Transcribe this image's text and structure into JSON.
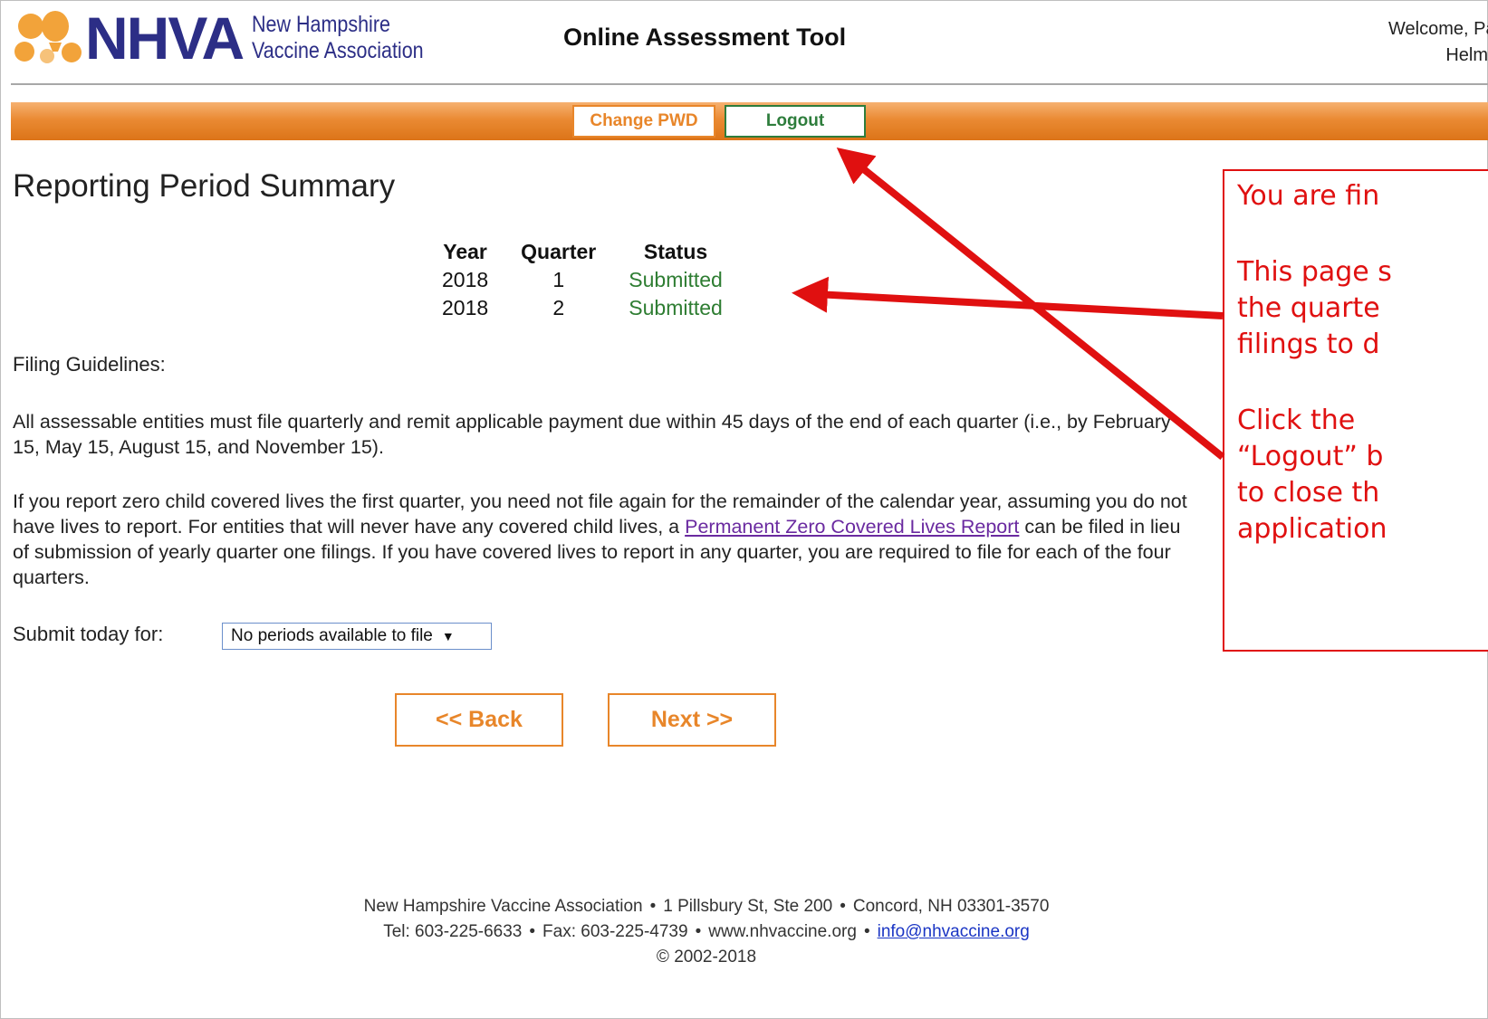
{
  "header": {
    "logo_text": "NHVA",
    "logo_subtitle_line1": "New Hampshire",
    "logo_subtitle_line2": "Vaccine Association",
    "app_title": "Online Assessment Tool",
    "welcome_line1": "Welcome, Patrick!",
    "welcome_line2": "Helms"
  },
  "nav": {
    "change_pwd_label": "Change PWD",
    "logout_label": "Logout"
  },
  "main": {
    "title": "Reporting Period Summary",
    "table": {
      "headers": [
        "Year",
        "Quarter",
        "Status"
      ],
      "rows": [
        {
          "year": "2018",
          "quarter": "1",
          "status": "Submitted"
        },
        {
          "year": "2018",
          "quarter": "2",
          "status": "Submitted"
        }
      ]
    },
    "guidelines_heading": "Filing Guidelines:",
    "para1": "All assessable entities must file quarterly and remit applicable payment due within 45 days of the end of each quarter (i.e., by February 15, May 15, August 15, and November 15).",
    "para2_before": "If you report zero child covered lives the first quarter, you need not file again for the remainder of the calendar year, assuming you do not have lives to report. For entities that will never have any covered child lives, a ",
    "para2_link": "Permanent Zero Covered Lives Report",
    "para2_after": " can be filed in lieu of submission of yearly quarter one filings. If you have covered lives to report in any quarter, you are required to file for each of the four quarters.",
    "submit_label": "Submit today for:",
    "period_select_value": "No periods available to file",
    "back_label": "<<  Back",
    "next_label": "Next  >>"
  },
  "footer": {
    "org": "New Hampshire Vaccine Association",
    "address": "1 Pillsbury St, Ste 200",
    "city": "Concord, NH 03301-3570",
    "tel": "Tel: 603-225-6633",
    "fax": "Fax: 603-225-4739",
    "website": "www.nhvaccine.org",
    "email": "info@nhvaccine.org",
    "copyright": "© 2002-2018"
  },
  "callout": {
    "line1": "You are fin",
    "line2": "This page s",
    "line3": "the quarte",
    "line4": "filings to d",
    "line5": "Click the",
    "line6": "“Logout” b",
    "line7": "to close th",
    "line8": "application"
  },
  "colors": {
    "brand_navy": "#2c2e86",
    "accent_orange": "#e8862a",
    "logout_green": "#2e7d3c",
    "status_green": "#2e7d32",
    "annotation_red": "#e01010"
  }
}
